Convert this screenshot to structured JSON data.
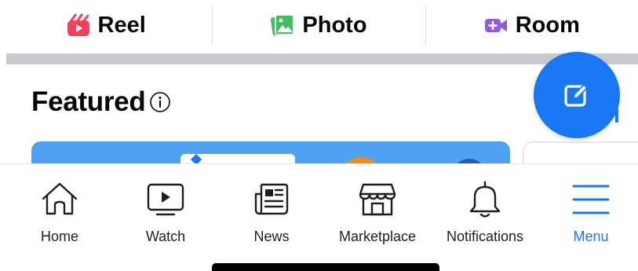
{
  "composer": {
    "items": [
      {
        "label": "Reel",
        "icon": "reel-icon",
        "color": "#f3425f"
      },
      {
        "label": "Photo",
        "icon": "photo-icon",
        "color": "#45bd62"
      },
      {
        "label": "Room",
        "icon": "room-video-icon",
        "color": "#8e5cdb"
      }
    ]
  },
  "featured": {
    "title": "Featured",
    "info_icon": "info-icon"
  },
  "fab": {
    "icon": "compose-edit-icon",
    "color": "#1877f2"
  },
  "bottom_nav": {
    "items": [
      {
        "label": "Home",
        "icon": "home-icon",
        "active": false
      },
      {
        "label": "Watch",
        "icon": "watch-video-icon",
        "active": false
      },
      {
        "label": "News",
        "icon": "news-icon",
        "active": false
      },
      {
        "label": "Marketplace",
        "icon": "marketplace-store-icon",
        "active": false
      },
      {
        "label": "Notifications",
        "icon": "bell-icon",
        "active": false
      },
      {
        "label": "Menu",
        "icon": "menu-hamburger-icon",
        "active": true
      }
    ],
    "active_color": "#1877f2",
    "inactive_color": "#1c1e21"
  }
}
